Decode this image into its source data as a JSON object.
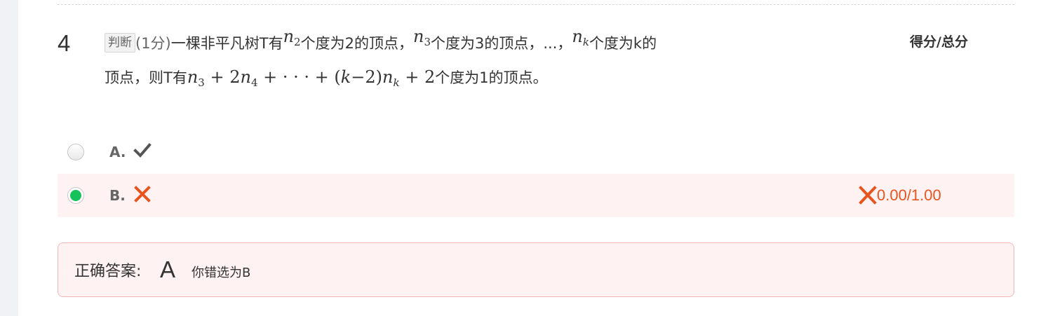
{
  "question": {
    "number": "4",
    "type_tag": "判断",
    "score_text": "(1分)",
    "text_1": "一棵非平凡树T有",
    "math_n2": "n",
    "math_n2_sub": "2",
    "text_2": "个度为2的顶点，",
    "math_n3": "n",
    "math_n3_sub": "3",
    "text_3": "个度为3的顶点，...，",
    "math_nk": "n",
    "math_nk_sub": "k",
    "text_4": "个度为k的",
    "text_5": "顶点，则T有",
    "formula": {
      "n": "n",
      "sub3": "3",
      "plus2": " + 2",
      "n4": "n",
      "sub4": "4",
      "dots": " + · · · + (",
      "k": "k",
      "minus2": "−2)",
      "nk": "n",
      "subk": "k",
      "plus2end": " + 2"
    },
    "text_6": "个度为1的顶点。"
  },
  "score_header": "得分/总分",
  "options": [
    {
      "letter": "A.",
      "icon": "check-icon",
      "selected": false
    },
    {
      "letter": "B.",
      "icon": "cross-icon",
      "selected": true
    }
  ],
  "result": {
    "icon": "cross-icon",
    "score": "0.00/1.00"
  },
  "answer": {
    "label": "正确答案:",
    "value": "A",
    "note": "你错选为B"
  },
  "colors": {
    "selected_radio": "#17c25a",
    "wrong_red": "#e8541e",
    "wrong_bg": "#fff2f2",
    "check_gray": "#555555"
  }
}
